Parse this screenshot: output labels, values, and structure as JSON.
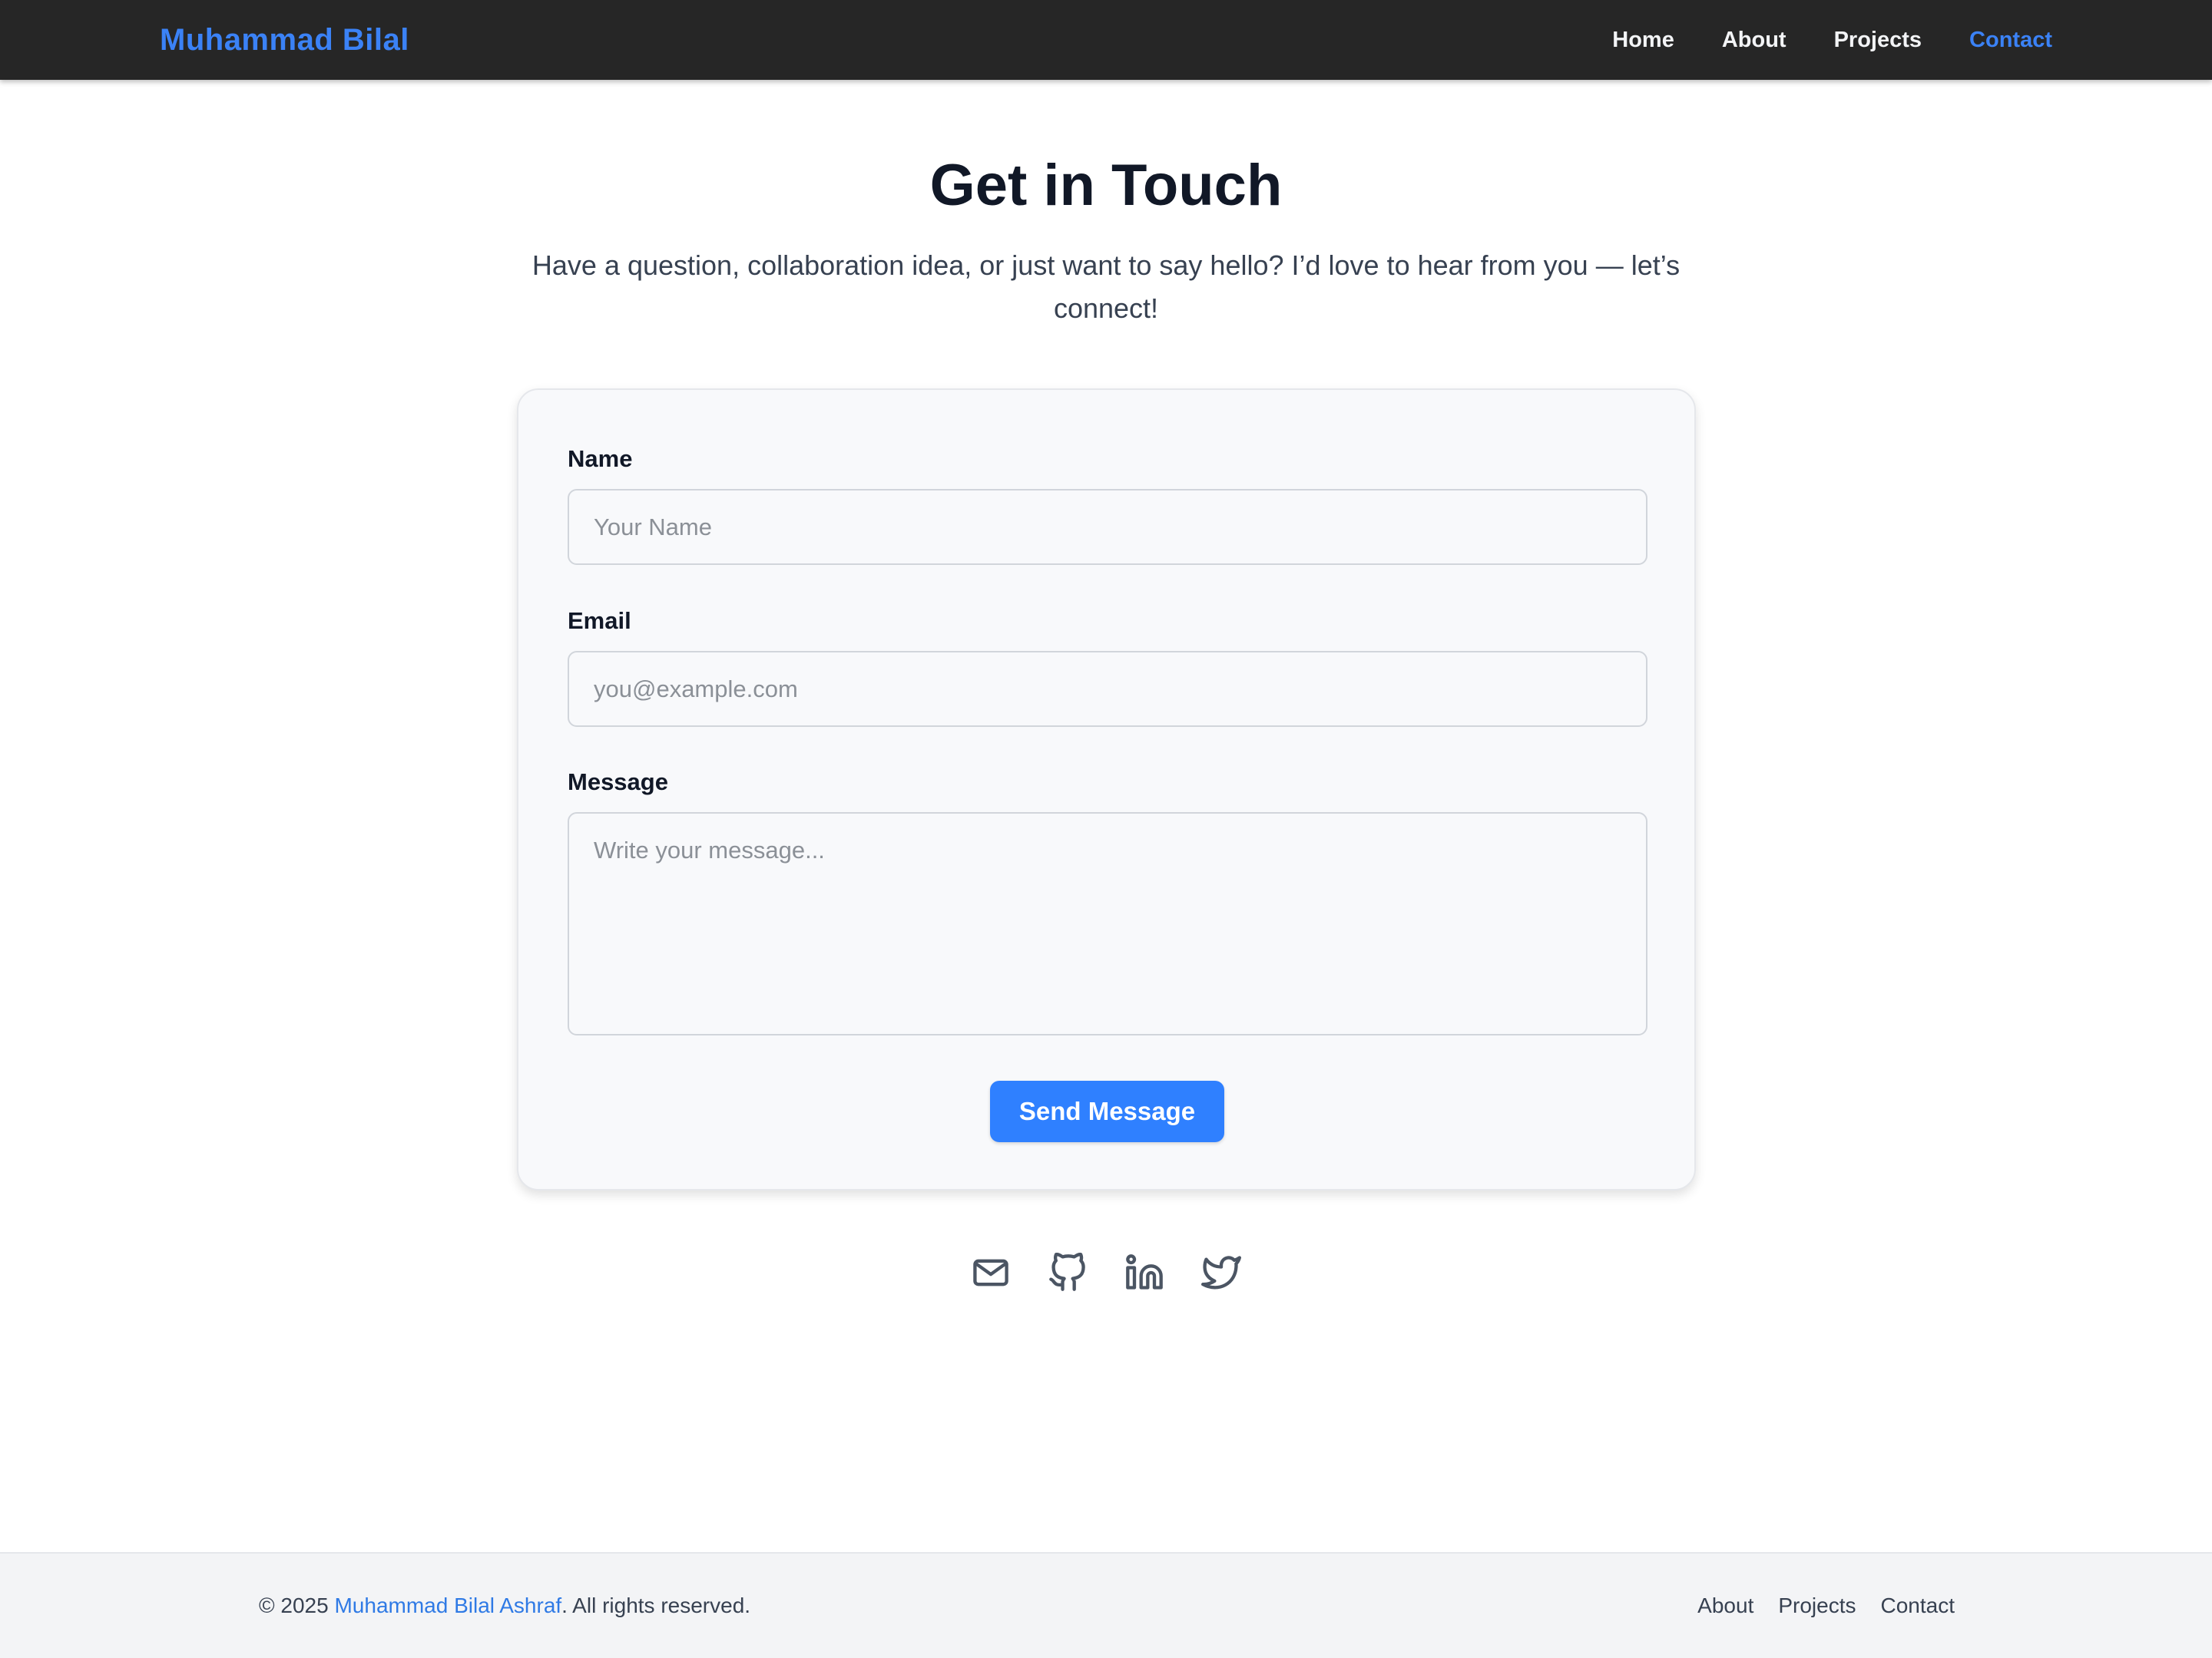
{
  "navbar": {
    "brand": "Muhammad Bilal",
    "links": [
      {
        "label": "Home",
        "active": false
      },
      {
        "label": "About",
        "active": false
      },
      {
        "label": "Projects",
        "active": false
      },
      {
        "label": "Contact",
        "active": true
      }
    ]
  },
  "header": {
    "title": "Get in Touch",
    "subtitle": "Have a question, collaboration idea, or just want to say hello? I’d love to hear from you — let’s connect!"
  },
  "form": {
    "name": {
      "label": "Name",
      "placeholder": "Your Name",
      "value": ""
    },
    "email": {
      "label": "Email",
      "placeholder": "you@example.com",
      "value": ""
    },
    "message": {
      "label": "Message",
      "placeholder": "Write your message...",
      "value": ""
    },
    "submit_label": "Send Message"
  },
  "socials": [
    {
      "icon": "mail-icon"
    },
    {
      "icon": "github-icon"
    },
    {
      "icon": "linkedin-icon"
    },
    {
      "icon": "twitter-icon"
    }
  ],
  "footer": {
    "copyright_prefix": "© 2025 ",
    "owner": "Muhammad Bilal Ashraf",
    "copyright_suffix": ". All rights reserved.",
    "links": [
      "About",
      "Projects",
      "Contact"
    ]
  },
  "colors": {
    "accent": "#3b82f6",
    "button": "#2f80ff",
    "navbar_bg": "#262626",
    "footer_bg": "#f3f4f6"
  }
}
